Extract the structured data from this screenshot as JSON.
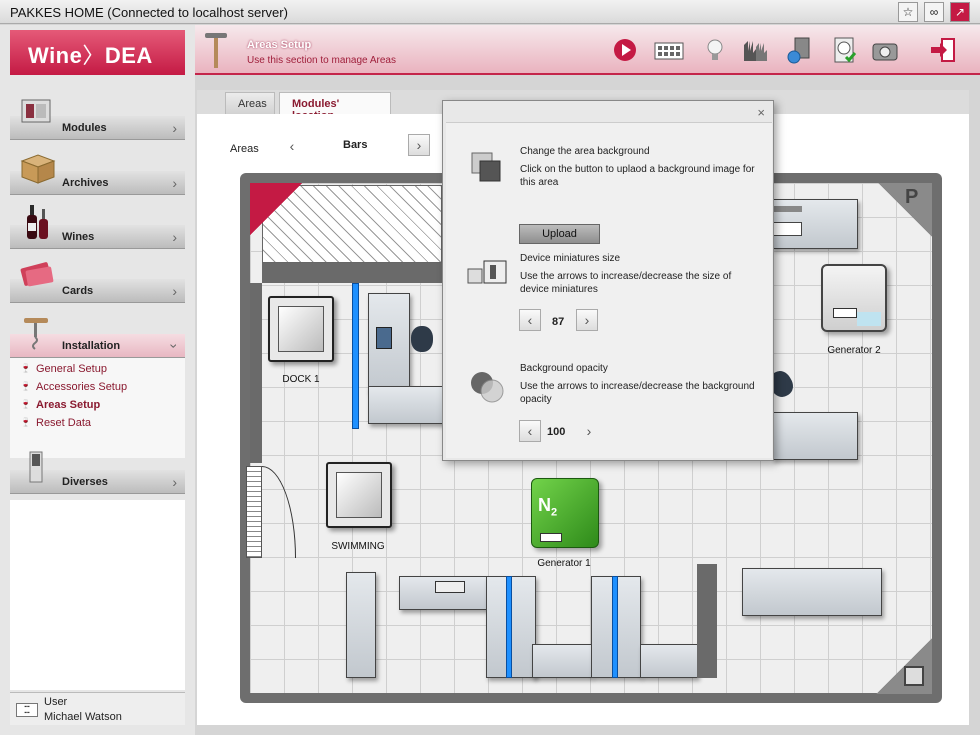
{
  "window": {
    "title": "PAKKES HOME (Connected to localhost server)"
  },
  "logo": {
    "part1": "Wine",
    "part2": "DEA"
  },
  "sidebar": {
    "modules": [
      {
        "label": "Modules"
      },
      {
        "label": "Archives"
      },
      {
        "label": "Wines"
      },
      {
        "label": "Cards"
      },
      {
        "label": "Installation"
      },
      {
        "label": "Diverses"
      }
    ],
    "installation_items": [
      "General Setup",
      "Accessories Setup",
      "Areas Setup",
      "Reset Data"
    ],
    "selected_item": "Areas Setup"
  },
  "user": {
    "caption": "User",
    "name": "Michael Watson"
  },
  "header": {
    "title": "Areas Setup",
    "subtitle": "Use this section to manage Areas"
  },
  "tabs": [
    "Areas",
    "Modules' location"
  ],
  "active_tab": "Modules' location",
  "areas_selector": {
    "label": "Areas",
    "value": "Bars"
  },
  "floorplan": {
    "labels": {
      "dock1": "DOCK 1",
      "swimming": "SWIMMING",
      "generator1": "Generator 1",
      "generator2": "Generator 2",
      "p_badge": "P"
    }
  },
  "dialog": {
    "close": "×",
    "background": {
      "title": "Change the area background",
      "text": "Click on the button to uplaod a background image for this area",
      "button": "Upload"
    },
    "miniatures": {
      "title": "Device miniatures size",
      "text": "Use the arrows to increase/decrease the size of device miniatures",
      "value": "87"
    },
    "opacity": {
      "title": "Background opacity",
      "text": "Use the arrows to increase/decrease the background opacity",
      "value": "100"
    }
  },
  "colors": {
    "brand": "#c41a44",
    "accent_blue": "#1e90ff"
  }
}
